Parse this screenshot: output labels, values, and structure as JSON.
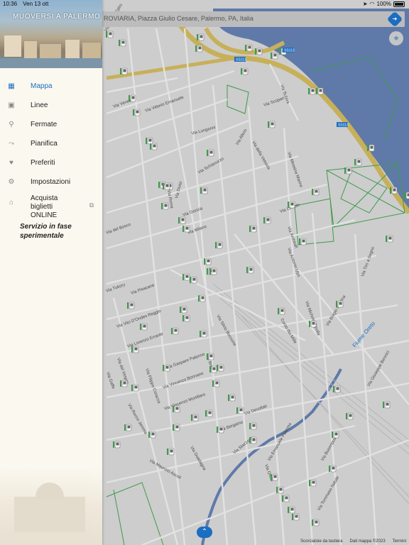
{
  "status": {
    "time": "10:36",
    "date": "Ven 13 ott",
    "battery": "100%"
  },
  "sidebar": {
    "title": "MUOVERSI A PALERMO",
    "items": [
      {
        "icon": "map-icon",
        "label": "Mappa",
        "active": true
      },
      {
        "icon": "bus-icon",
        "label": "Linee"
      },
      {
        "icon": "pin-icon",
        "label": "Fermate"
      },
      {
        "icon": "route-icon",
        "label": "Pianifica"
      },
      {
        "icon": "heart-icon",
        "label": "Preferiti"
      },
      {
        "icon": "gear-icon",
        "label": "Impostazioni"
      },
      {
        "icon": "ticket-icon",
        "label": "Acquista biglietti ONLINE"
      }
    ],
    "note": "Servizio in fase sperimentale"
  },
  "search": {
    "value": "ROVIARIA, Piazza Giulio Cesare, Palermo, PA, Italia"
  },
  "map": {
    "streets": [
      "Via Vittorio Emanuele",
      "Via Venezia",
      "Via Lungarini",
      "Via Alloro",
      "Via Scopari",
      "Via Butera",
      "Via Schiavuzzo",
      "Via Divisi",
      "Via Roma",
      "Via Gorizia",
      "Via Milano",
      "Via del Bosco",
      "Via Tukory",
      "Via Pisacane",
      "Via Vito D'Ondes Reggio",
      "Via Lorenzo Errante",
      "Via Gaspare Palermo",
      "Via Vincenzo Mortillaro",
      "Via Filippo Corazza",
      "Via Rocco Jemma",
      "Via Vincenzo Bonnano",
      "Via Decollati",
      "Via Bergamo",
      "Via Stazzone",
      "Via Oreto",
      "Via Emanuele Palermo",
      "Via Buonriposo",
      "Via Guadagna",
      "Via Maurizio Ascoli",
      "Corso dei Mille",
      "Via Tiro a Segno",
      "Via Giuseppe Bennici",
      "Via Messina Marine",
      "Via Archirafi",
      "Via Antonio Ugo",
      "Via Lincoln",
      "Via Silvio Boccone",
      "Via Bisco",
      "Via Gaffe",
      "Via del Vespro",
      "Fiume Oreto",
      "Via Michele Cipolla",
      "Via Biagio Cantina",
      "Via Tommaso Natale",
      "Via della Vetreria",
      "Via Vittorio Epiro"
    ],
    "road_badges": [
      "SS113",
      "SS113",
      "SS113"
    ],
    "footer": [
      "Scorciatoie da tastiera",
      "Dati mappa ©2023",
      "Termini"
    ]
  },
  "colors": {
    "accent": "#1b6ec2",
    "sidebar_bg": "#fbf8ef",
    "map_bg": "#cdcdcd",
    "water": "#5f7aa8",
    "highway": "#c7b05a",
    "park": "#3f9a4c"
  }
}
